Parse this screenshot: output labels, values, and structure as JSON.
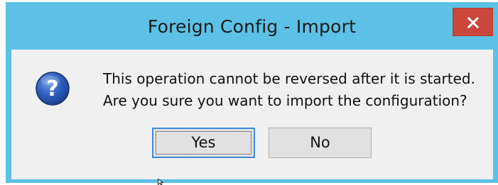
{
  "window": {
    "title": "Foreign Config - Import",
    "close_glyph": "x"
  },
  "message": {
    "line1": "This operation cannot be reversed after it is started.",
    "line2": "Are you sure you want to import the configuration?"
  },
  "icon": {
    "name": "question-icon",
    "glyph": "?"
  },
  "buttons": {
    "yes_label": "Yes",
    "no_label": "No"
  },
  "colors": {
    "titlebar": "#5cc1e5",
    "close_button": "#c9483b",
    "content_bg": "#f0f0f0",
    "button_bg": "#e1e1e1",
    "focus_border": "#3f8ad8"
  }
}
